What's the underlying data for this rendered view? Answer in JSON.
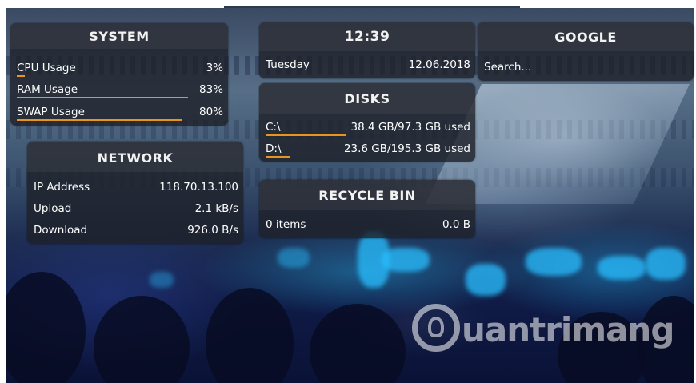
{
  "system": {
    "title": "SYSTEM",
    "rows": [
      {
        "label": "CPU Usage",
        "value": "3%",
        "fraction": 0.03
      },
      {
        "label": "RAM Usage",
        "value": "83%",
        "fraction": 0.83
      },
      {
        "label": "SWAP Usage",
        "value": "80%",
        "fraction": 0.8
      }
    ]
  },
  "clock": {
    "time": "12:39",
    "day": "Tuesday",
    "date": "12.06.2018"
  },
  "google": {
    "title": "GOOGLE",
    "placeholder": "Search..."
  },
  "disks": {
    "title": "DISKS",
    "rows": [
      {
        "label": "C:\\",
        "value": "38.4 GB/97.3 GB used",
        "fraction": 0.39
      },
      {
        "label": "D:\\",
        "value": "23.6 GB/195.3 GB used",
        "fraction": 0.12
      }
    ]
  },
  "network": {
    "title": "NETWORK",
    "rows": [
      {
        "label": "IP Address",
        "value": "118.70.13.100"
      },
      {
        "label": "Upload",
        "value": "2.1 kB/s"
      },
      {
        "label": "Download",
        "value": "926.0 B/s"
      }
    ]
  },
  "recycle": {
    "title": "RECYCLE BIN",
    "items": "0 items",
    "size": "0.0 B"
  },
  "watermark": {
    "text": "uantrimang"
  },
  "colors": {
    "accent": "#e8961b",
    "panel": "#1e2128"
  }
}
